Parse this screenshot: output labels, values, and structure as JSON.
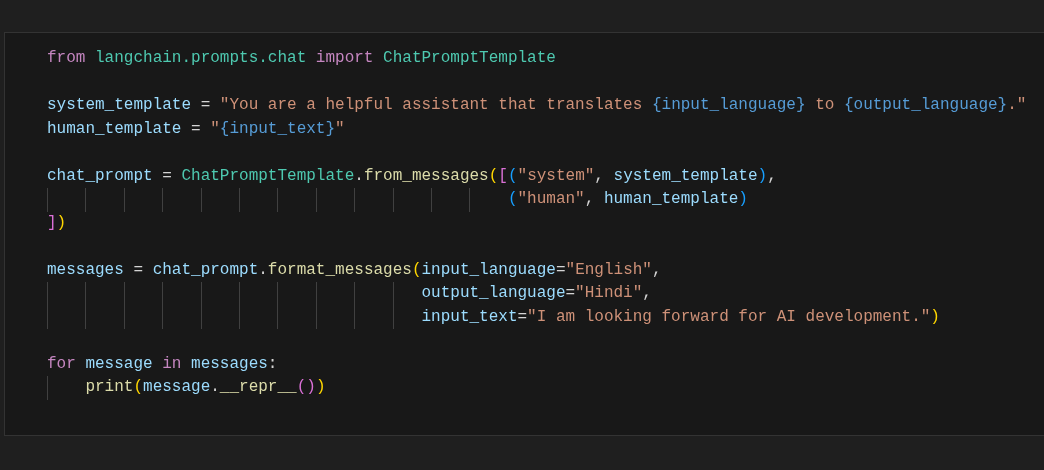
{
  "code_cell": {
    "lines": [
      {
        "kind": "code",
        "tokens": [
          {
            "text": "from ",
            "kind": "keyword"
          },
          {
            "text": "langchain.prompts.chat ",
            "kind": "module"
          },
          {
            "text": "import ",
            "kind": "keyword"
          },
          {
            "text": "ChatPromptTemplate",
            "kind": "class"
          }
        ]
      },
      {
        "kind": "blank"
      },
      {
        "kind": "code",
        "tokens": [
          {
            "text": "system_template",
            "kind": "variable"
          },
          {
            "text": " = ",
            "kind": "plain"
          },
          {
            "text": "\"You are a helpful assistant that translates ",
            "kind": "string"
          },
          {
            "text": "{input_language}",
            "kind": "placeholder"
          },
          {
            "text": " to ",
            "kind": "string"
          },
          {
            "text": "{output_language}",
            "kind": "placeholder"
          },
          {
            "text": ".\"",
            "kind": "string"
          }
        ]
      },
      {
        "kind": "code",
        "tokens": [
          {
            "text": "human_template",
            "kind": "variable"
          },
          {
            "text": " = ",
            "kind": "plain"
          },
          {
            "text": "\"",
            "kind": "string"
          },
          {
            "text": "{input_text}",
            "kind": "placeholder"
          },
          {
            "text": "\"",
            "kind": "string"
          }
        ]
      },
      {
        "kind": "blank"
      },
      {
        "kind": "code",
        "tokens": [
          {
            "text": "chat_prompt",
            "kind": "variable"
          },
          {
            "text": " = ",
            "kind": "plain"
          },
          {
            "text": "ChatPromptTemplate",
            "kind": "class"
          },
          {
            "text": ".",
            "kind": "plain"
          },
          {
            "text": "from_messages",
            "kind": "function"
          },
          {
            "text": "(",
            "kind": "bracket1"
          },
          {
            "text": "[",
            "kind": "bracket2"
          },
          {
            "text": "(",
            "kind": "bracket3"
          },
          {
            "text": "\"system\"",
            "kind": "string"
          },
          {
            "text": ", ",
            "kind": "plain"
          },
          {
            "text": "system_template",
            "kind": "variable"
          },
          {
            "text": ")",
            "kind": "bracket3"
          },
          {
            "text": ",",
            "kind": "plain"
          }
        ]
      },
      {
        "kind": "code",
        "tokens": [
          {
            "text": "                                                (",
            "kind": "bracket3"
          },
          {
            "text": "\"human\"",
            "kind": "string"
          },
          {
            "text": ", ",
            "kind": "plain"
          },
          {
            "text": "human_template",
            "kind": "variable"
          },
          {
            "text": ")",
            "kind": "bracket3"
          }
        ]
      },
      {
        "kind": "code",
        "tokens": [
          {
            "text": "]",
            "kind": "bracket2"
          },
          {
            "text": ")",
            "kind": "bracket1"
          }
        ]
      },
      {
        "kind": "blank"
      },
      {
        "kind": "code",
        "tokens": [
          {
            "text": "messages",
            "kind": "variable"
          },
          {
            "text": " = ",
            "kind": "plain"
          },
          {
            "text": "chat_prompt",
            "kind": "variable"
          },
          {
            "text": ".",
            "kind": "plain"
          },
          {
            "text": "format_messages",
            "kind": "function"
          },
          {
            "text": "(",
            "kind": "bracket1"
          },
          {
            "text": "input_language",
            "kind": "variable"
          },
          {
            "text": "=",
            "kind": "plain"
          },
          {
            "text": "\"English\"",
            "kind": "string"
          },
          {
            "text": ",",
            "kind": "plain"
          }
        ]
      },
      {
        "kind": "code",
        "tokens": [
          {
            "text": "                                       output_language",
            "kind": "variable"
          },
          {
            "text": "=",
            "kind": "plain"
          },
          {
            "text": "\"Hindi\"",
            "kind": "string"
          },
          {
            "text": ",",
            "kind": "plain"
          }
        ]
      },
      {
        "kind": "code",
        "tokens": [
          {
            "text": "                                       input_text",
            "kind": "variable"
          },
          {
            "text": "=",
            "kind": "plain"
          },
          {
            "text": "\"I am looking forward for AI development.\"",
            "kind": "string"
          },
          {
            "text": ")",
            "kind": "bracket1"
          }
        ]
      },
      {
        "kind": "blank"
      },
      {
        "kind": "code",
        "tokens": [
          {
            "text": "for ",
            "kind": "keyword"
          },
          {
            "text": "message ",
            "kind": "variable"
          },
          {
            "text": "in ",
            "kind": "keyword"
          },
          {
            "text": "messages",
            "kind": "variable"
          },
          {
            "text": ":",
            "kind": "plain"
          }
        ]
      },
      {
        "kind": "code",
        "tokens": [
          {
            "text": "    print",
            "kind": "function"
          },
          {
            "text": "(",
            "kind": "bracket1"
          },
          {
            "text": "message",
            "kind": "variable"
          },
          {
            "text": ".",
            "kind": "plain"
          },
          {
            "text": "__repr__",
            "kind": "function"
          },
          {
            "text": "(",
            "kind": "bracket2"
          },
          {
            "text": ")",
            "kind": "bracket2"
          },
          {
            "text": ")",
            "kind": "bracket1"
          }
        ]
      }
    ]
  }
}
